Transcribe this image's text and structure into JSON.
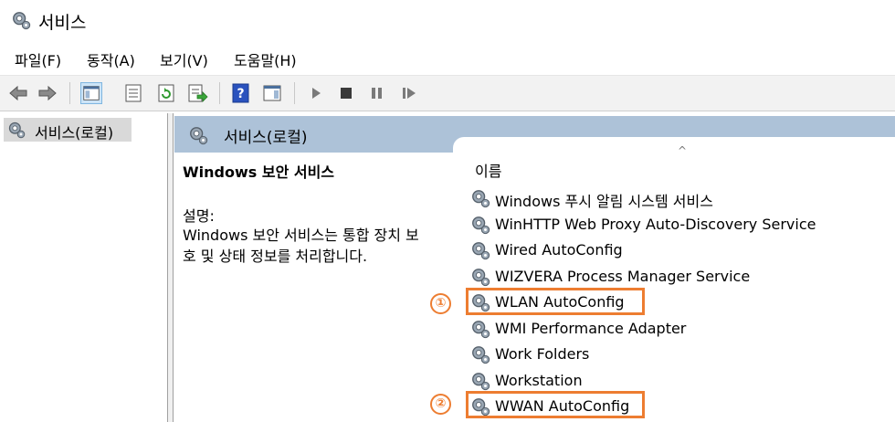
{
  "window": {
    "title": "서비스"
  },
  "menu": [
    "파일(F)",
    "동작(A)",
    "보기(V)",
    "도움말(H)"
  ],
  "toolbar_icons": [
    "back-arrow-icon",
    "forward-arrow-icon",
    "show-tree-icon",
    "properties-icon",
    "refresh-icon",
    "export-list-icon",
    "help-icon",
    "show-action-pane-icon",
    "start-service-icon",
    "stop-service-icon",
    "pause-service-icon",
    "restart-service-icon"
  ],
  "tree": {
    "item": "서비스(로컬)"
  },
  "content": {
    "header": "서비스(로컬)",
    "selected_service": "Windows 보안 서비스",
    "desc_label": "설명:",
    "desc_line1": "Windows 보안 서비스는 통합 장치 보",
    "desc_line2": "호 및 상태 정보를 처리합니다.",
    "column_name": "이름",
    "sort_indicator": "^",
    "services": [
      "Windows 푸시 알림 시스템 서비스",
      "WinHTTP Web Proxy Auto-Discovery Service",
      "Wired AutoConfig",
      "WIZVERA Process Manager Service",
      "WLAN AutoConfig",
      "WMI Performance Adapter",
      "Work Folders",
      "Workstation",
      "WWAN AutoConfig"
    ]
  },
  "annotations": [
    "①",
    "②"
  ],
  "colors": {
    "accent": "#ed7d31",
    "header_bg": "#adc2d8"
  }
}
